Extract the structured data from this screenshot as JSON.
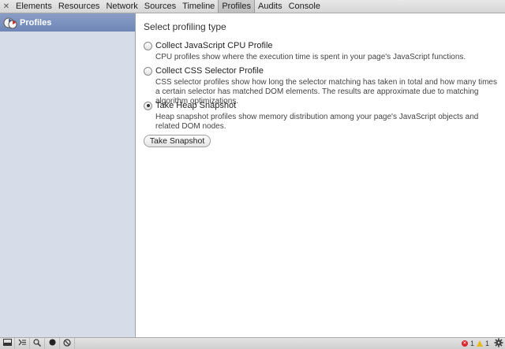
{
  "toolbar": {
    "close_symbol": "✕",
    "tabs": [
      {
        "label": "Elements"
      },
      {
        "label": "Resources"
      },
      {
        "label": "Network"
      },
      {
        "label": "Sources"
      },
      {
        "label": "Timeline"
      },
      {
        "label": "Profiles",
        "selected": true
      },
      {
        "label": "Audits"
      },
      {
        "label": "Console"
      }
    ]
  },
  "sidebar": {
    "items": [
      {
        "label": "Profiles",
        "icon": "profiles-icon",
        "selected": true
      }
    ]
  },
  "main": {
    "heading": "Select profiling type",
    "options": [
      {
        "label": "Collect JavaScript CPU Profile",
        "checked": false,
        "description": "CPU profiles show where the execution time is spent in your page's JavaScript functions."
      },
      {
        "label": "Collect CSS Selector Profile",
        "checked": false,
        "description": "CSS selector profiles show how long the selector matching has taken in total and how many times a certain selector has matched DOM elements. The results are approximate due to matching algorithm optimizations."
      },
      {
        "label": "Take Heap Snapshot",
        "checked": true,
        "description": "Heap snapshot profiles show memory distribution among your page's JavaScript objects and related DOM nodes."
      }
    ],
    "button_label": "Take Snapshot"
  },
  "statusbar": {
    "left_icons": [
      "dock-icon",
      "console-drawer-icon",
      "search-icon",
      "record-icon",
      "clear-icon"
    ],
    "error_count": "1",
    "warning_count": "1",
    "settings_icon": "gear-icon"
  },
  "colors": {
    "sidebar_bg": "#d7dde8",
    "sidebar_selected": "#7b90bd",
    "error": "#d8262e",
    "warning": "#e5b920"
  }
}
